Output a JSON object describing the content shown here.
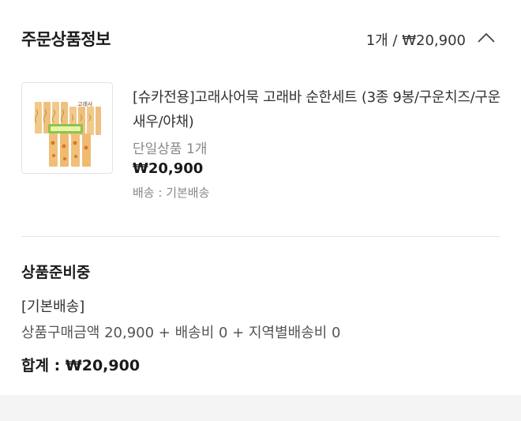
{
  "header": {
    "title": "주문상품정보",
    "summary": "1개 / ₩20,900"
  },
  "product": {
    "name": "[슈카전용]고래사어묵 고래바 순한세트 (3종 9봉/구운치즈/구운새우/야채)",
    "option": "단일상품 1개",
    "price": "₩20,900",
    "shipping": "배송 : 기본배송",
    "thumbnail_icon": "fishcake-product-image"
  },
  "delivery": {
    "status": "상품준비중",
    "type": "[기본배송]",
    "breakdown": "상품구매금액 20,900 + 배송비 0 + 지역별배송비 0",
    "total": "합계 : ₩20,900"
  }
}
